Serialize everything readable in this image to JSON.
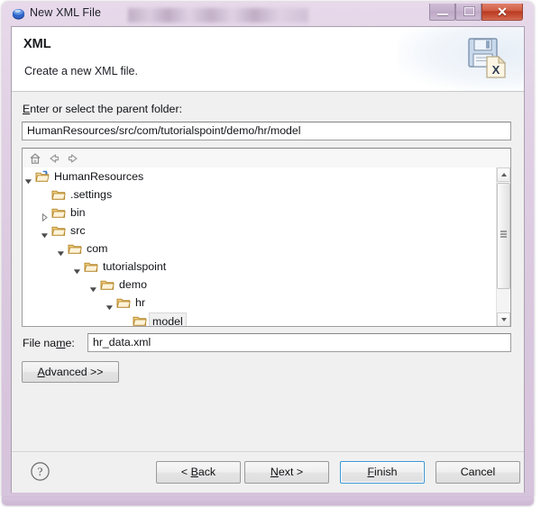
{
  "window": {
    "title": "New XML File",
    "icon": "eclipse-sphere-icon",
    "controls": {
      "minimize": "minimize-icon",
      "maximize": "maximize-icon",
      "close": "✕"
    }
  },
  "header": {
    "title": "XML",
    "subtitle": "Create a new XML file.",
    "icon": "xml-save-file-icon"
  },
  "form": {
    "parent_folder_label_pre": "",
    "parent_folder_label_accel": "E",
    "parent_folder_label_post": "nter or select the parent folder:",
    "parent_folder_value": "HumanResources/src/com/tutorialspoint/demo/hr/model",
    "filename_label_pre": "File na",
    "filename_label_accel": "m",
    "filename_label_post": "e:",
    "filename_value": "hr_data.xml",
    "advanced_label_pre": "",
    "advanced_label_accel": "A",
    "advanced_label_post": "dvanced >>"
  },
  "tree_toolbar": {
    "home": "home-icon",
    "back": "back-arrow-icon",
    "forward": "forward-arrow-icon"
  },
  "tree": {
    "items": [
      {
        "label": "HumanResources",
        "depth": 0,
        "expander": "expanded",
        "icon": "project-folder-icon",
        "selected": false
      },
      {
        "label": ".settings",
        "depth": 1,
        "expander": "none",
        "icon": "folder-icon",
        "selected": false
      },
      {
        "label": "bin",
        "depth": 1,
        "expander": "collapsed",
        "icon": "folder-icon",
        "selected": false
      },
      {
        "label": "src",
        "depth": 1,
        "expander": "expanded",
        "icon": "folder-icon",
        "selected": false
      },
      {
        "label": "com",
        "depth": 2,
        "expander": "expanded",
        "icon": "folder-icon",
        "selected": false
      },
      {
        "label": "tutorialspoint",
        "depth": 3,
        "expander": "expanded",
        "icon": "folder-icon",
        "selected": false
      },
      {
        "label": "demo",
        "depth": 4,
        "expander": "expanded",
        "icon": "folder-icon",
        "selected": false
      },
      {
        "label": "hr",
        "depth": 5,
        "expander": "expanded",
        "icon": "folder-icon",
        "selected": false
      },
      {
        "label": "model",
        "depth": 6,
        "expander": "none",
        "icon": "folder-icon",
        "selected": true
      },
      {
        "label": "",
        "depth": 6,
        "expander": "none",
        "icon": "folder-icon",
        "selected": false
      }
    ],
    "scrollbar": {
      "up_arrow": "scroll-up-icon",
      "down_arrow": "scroll-down-icon"
    }
  },
  "footer": {
    "help": "?",
    "buttons": [
      {
        "id": "back",
        "label_pre": "< ",
        "label_accel": "B",
        "label_post": "ack",
        "default": false
      },
      {
        "id": "next",
        "label_pre": "",
        "label_accel": "N",
        "label_post": "ext >",
        "default": false
      },
      {
        "id": "finish",
        "label_pre": "",
        "label_accel": "F",
        "label_post": "inish",
        "default": true
      },
      {
        "id": "cancel",
        "label_pre": "",
        "label_accel": "",
        "label_post": "Cancel",
        "default": false
      }
    ]
  },
  "colors": {
    "frame": "#d9c7de",
    "close_button": "#b93a22",
    "default_button_focus": "#3c95d4",
    "folder": "#e8b84b",
    "panel": "#f0f0f0"
  }
}
